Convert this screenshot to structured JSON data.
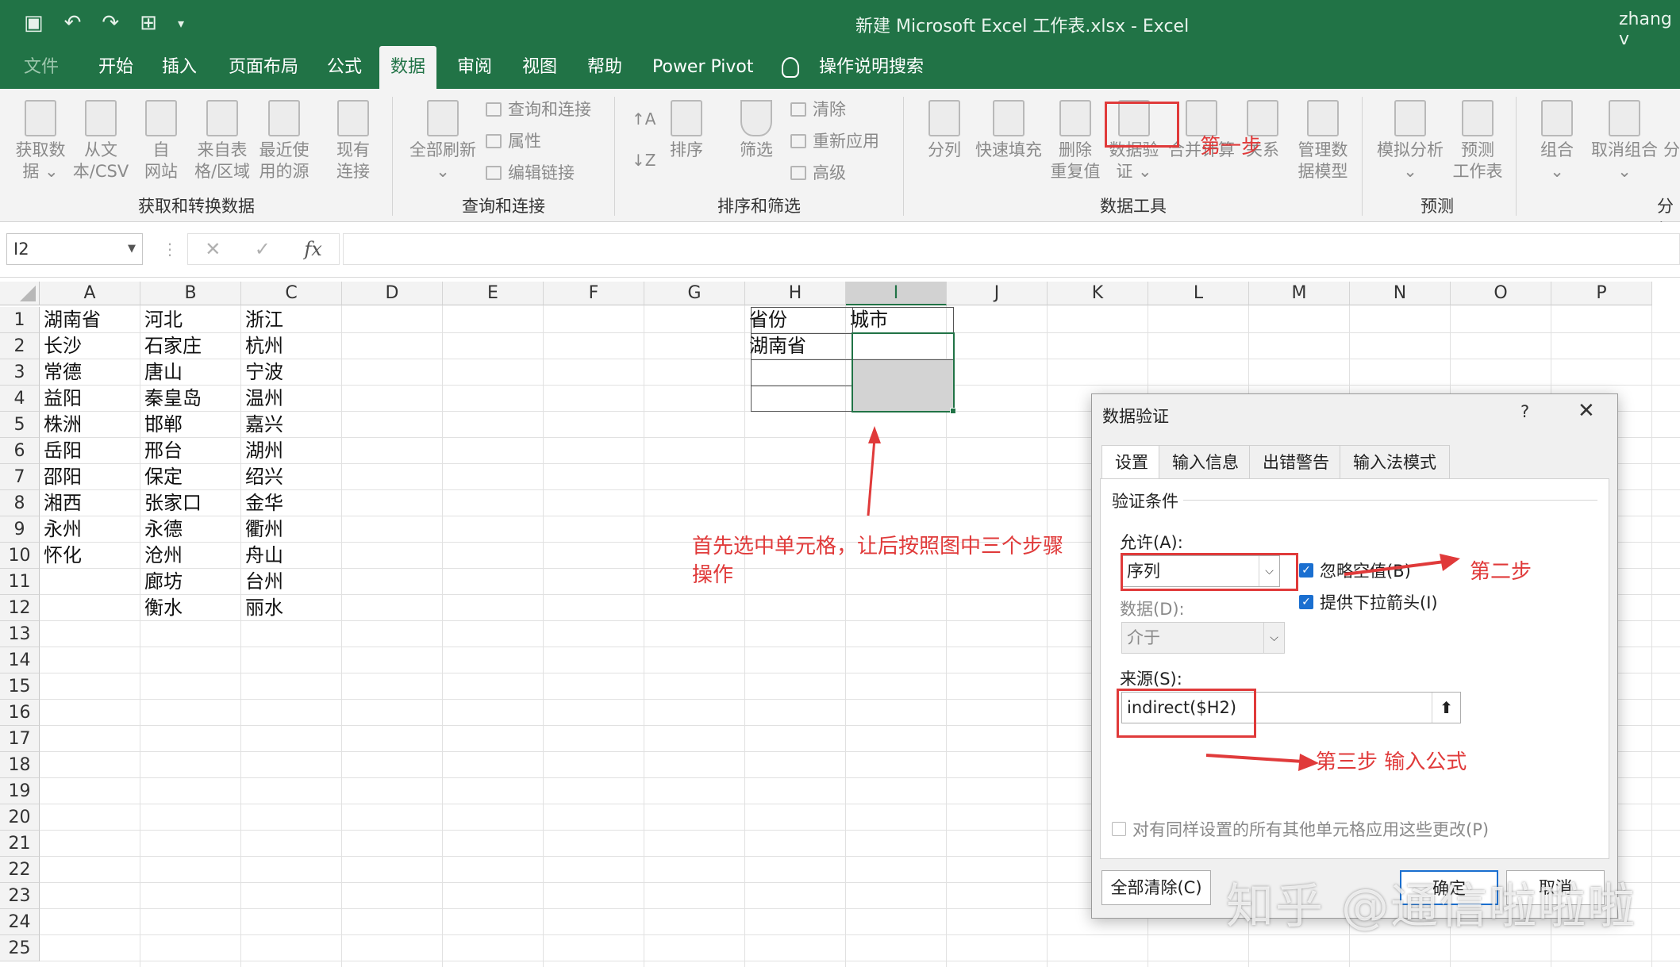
{
  "window": {
    "title": "新建 Microsoft Excel 工作表.xlsx  -  Excel",
    "user": "zhang v",
    "qat": [
      "save-icon",
      "undo-icon",
      "redo-icon",
      "table-icon",
      "customize-icon"
    ]
  },
  "tabs": [
    "文件",
    "开始",
    "插入",
    "页面布局",
    "公式",
    "数据",
    "审阅",
    "视图",
    "帮助",
    "Power Pivot",
    "操作说明搜索"
  ],
  "active_tab": "数据",
  "ribbon": {
    "get_transform": {
      "group": "获取和转换数据",
      "buttons": [
        {
          "l1": "获取数",
          "l2": "据 ⌄"
        },
        {
          "l1": "从文",
          "l2": "本/CSV"
        },
        {
          "l1": "自",
          "l2": "网站"
        },
        {
          "l1": "来自表",
          "l2": "格/区域"
        },
        {
          "l1": "最近使",
          "l2": "用的源"
        },
        {
          "l1": "现有",
          "l2": "连接"
        }
      ]
    },
    "query": {
      "group": "查询和连接",
      "refresh": {
        "l1": "全部刷新",
        "l2": "⌄"
      },
      "small": [
        "查询和连接",
        "属性",
        "编辑链接"
      ]
    },
    "sort_filter": {
      "group": "排序和筛选",
      "sort": "排序",
      "filter": "筛选",
      "small": [
        "清除",
        "重新应用",
        "高级"
      ]
    },
    "data_tools": {
      "group": "数据工具",
      "buttons": [
        {
          "l1": "分列",
          "l2": ""
        },
        {
          "l1": "快速填充",
          "l2": ""
        },
        {
          "l1": "删除",
          "l2": "重复值"
        },
        {
          "l1": "数据验",
          "l2": "证 ⌄"
        },
        {
          "l1": "合并计算",
          "l2": ""
        },
        {
          "l1": "关系",
          "l2": ""
        },
        {
          "l1": "管理数",
          "l2": "据模型"
        }
      ]
    },
    "forecast": {
      "group": "预测",
      "buttons": [
        {
          "l1": "模拟分析",
          "l2": "⌄"
        },
        {
          "l1": "预测",
          "l2": "工作表"
        }
      ]
    },
    "outline": {
      "group": "分级",
      "buttons": [
        {
          "l1": "组合",
          "l2": "⌄"
        },
        {
          "l1": "取消组合",
          "l2": "⌄"
        },
        {
          "l1": "分",
          "l2": ""
        }
      ]
    }
  },
  "formula_bar": {
    "name_box": "I2",
    "cancel": "✕",
    "enter": "✓",
    "fx": "fx",
    "value": ""
  },
  "sheet": {
    "columns": [
      "A",
      "B",
      "C",
      "D",
      "E",
      "F",
      "G",
      "H",
      "I",
      "J",
      "K",
      "L",
      "M",
      "N",
      "O",
      "P"
    ],
    "selected_column": "I",
    "rows": [
      "1",
      "2",
      "3",
      "4",
      "5",
      "6",
      "7",
      "8",
      "9",
      "10",
      "11",
      "12",
      "13",
      "14",
      "15",
      "16",
      "17",
      "18",
      "19",
      "20",
      "21",
      "22",
      "23",
      "24",
      "25"
    ],
    "colA": [
      "湖南省",
      "长沙",
      "常德",
      "益阳",
      "株洲",
      "岳阳",
      "邵阳",
      "湘西",
      "永州",
      "怀化"
    ],
    "colB": [
      "河北",
      "石家庄",
      "唐山",
      "秦皇岛",
      "邯郸",
      "邢台",
      "保定",
      "张家口",
      "永德",
      "沧州",
      "廊坊",
      "衡水"
    ],
    "colC": [
      "浙江",
      "杭州",
      "宁波",
      "温州",
      "嘉兴",
      "湖州",
      "绍兴",
      "金华",
      "衢州",
      "舟山",
      "台州",
      "丽水"
    ],
    "H1": "省份",
    "I1": "城市",
    "H2": "湖南省"
  },
  "annotations": {
    "step1": "第一步",
    "step2": "第二步",
    "step3": "第三步   输入公式",
    "instruction_line1": "首先选中单元格，让后按照图中三个步骤",
    "instruction_line2": "操作"
  },
  "dialog": {
    "title": "数据验证",
    "help": "?",
    "close": "✕",
    "tabs": [
      "设置",
      "输入信息",
      "出错警告",
      "输入法模式"
    ],
    "active_tab": "设置",
    "section": "验证条件",
    "allow_label": "允许(A):",
    "allow_value": "序列",
    "ignore_blank": "忽略空值(B)",
    "dropdown_arrow": "提供下拉箭头(I)",
    "data_label": "数据(D):",
    "data_value": "介于",
    "source_label": "来源(S):",
    "source_value": "indirect($H2)",
    "apply_all": "对有同样设置的所有其他单元格应用这些更改(P)",
    "clear_all": "全部清除(C)",
    "ok": "确定",
    "cancel": "取消"
  },
  "watermark": "知乎 @通信啦啦啦",
  "colors": {
    "excel_green": "#217346",
    "annotation_red": "#e03a3a",
    "checkbox_blue": "#1a6fd0"
  }
}
